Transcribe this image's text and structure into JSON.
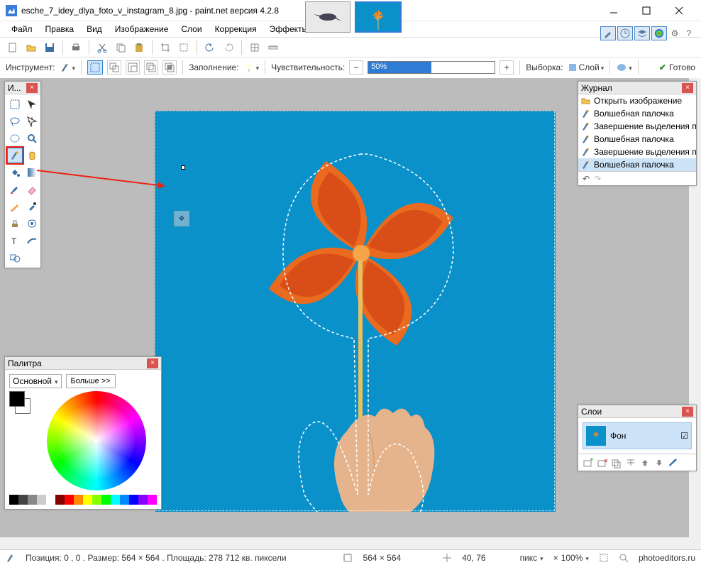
{
  "titlebar": {
    "title": "esche_7_idey_dlya_foto_v_instagram_8.jpg - paint.net версия 4.2.8"
  },
  "menu": {
    "file": "Файл",
    "edit": "Правка",
    "view": "Вид",
    "image": "Изображение",
    "layers": "Слои",
    "adjust": "Коррекция",
    "effects": "Эффекты"
  },
  "optbar": {
    "tool_label": "Инструмент:",
    "fill_label": "Заполнение:",
    "tol_label": "Чувствительность:",
    "tol_value": "50%",
    "sample_label": "Выборка:",
    "sample_value": "Слой",
    "ready": "Готово"
  },
  "panels": {
    "tools_title": "И...",
    "history_title": "Журнал",
    "history_items": [
      {
        "icon": "open",
        "label": "Открыть изображение"
      },
      {
        "icon": "wand",
        "label": "Волшебная палочка"
      },
      {
        "icon": "wand",
        "label": "Завершение выделения палочкой"
      },
      {
        "icon": "wand",
        "label": "Волшебная палочка"
      },
      {
        "icon": "wand",
        "label": "Завершение выделения палочкой"
      },
      {
        "icon": "wand",
        "label": "Волшебная палочка"
      }
    ],
    "layers_title": "Слои",
    "layer_name": "Фон",
    "palette_title": "Палитра",
    "palette_primary": "Основной",
    "palette_more": "Больше >>"
  },
  "status": {
    "pos": "Позиция: 0 , 0 . Размер: 564  × 564 . Площадь: 278 712 кв. пиксели",
    "dims": "564 × 564",
    "cursor": "40, 76",
    "unit": "пикс",
    "zoom": "100%",
    "brand": "photoeditors.ru"
  },
  "colors": {
    "accent": "#2e7cd6",
    "canvas": "#0a91c9"
  }
}
